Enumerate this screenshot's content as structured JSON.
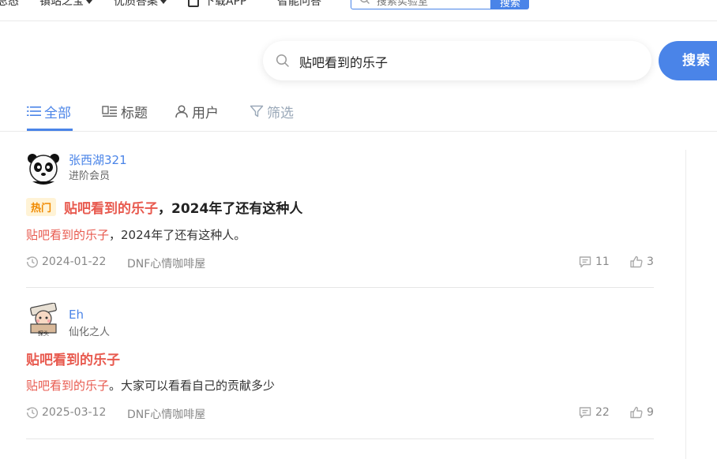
{
  "top_nav": {
    "items": [
      "总态",
      "镇站之宝",
      "优质答案",
      "下载APP",
      "智能问答"
    ],
    "search_placeholder": "搜索实验室",
    "search_button": "搜索"
  },
  "search": {
    "query": "贴吧看到的乐子",
    "button": "搜索"
  },
  "tabs": [
    {
      "label": "全部",
      "icon": "list-icon",
      "state": "active"
    },
    {
      "label": "标题",
      "icon": "title-icon",
      "state": "normal"
    },
    {
      "label": "用户",
      "icon": "user-icon",
      "state": "normal"
    },
    {
      "label": "筛选",
      "icon": "filter-icon",
      "state": "disabled"
    }
  ],
  "posts": [
    {
      "username": "张西湖321",
      "level": "进阶会员",
      "badge": "热门",
      "title_highlight": "贴吧看到的乐子",
      "title_rest": "，2024年了还有这种人",
      "snippet_highlight": "贴吧看到的乐子",
      "snippet_rest": "，2024年了还有这种人。",
      "date": "2024-01-22",
      "forum": "DNF心情咖啡屋",
      "comments": "11",
      "likes": "3"
    },
    {
      "username": "Eh",
      "level": "仙化之人",
      "avatar_caption": "探头",
      "title_highlight": "贴吧看到的乐子",
      "title_rest": "",
      "snippet_highlight": "贴吧看到的乐子",
      "snippet_rest": "。大家可以看看自己的贡献多少",
      "date": "2025-03-12",
      "forum": "DNF心情咖啡屋",
      "comments": "22",
      "likes": "9"
    }
  ],
  "colors": {
    "accent": "#4a84e8",
    "highlight": "#e85a4f",
    "hot_badge_bg": "#fff3d6",
    "hot_badge_text": "#f08a00"
  }
}
